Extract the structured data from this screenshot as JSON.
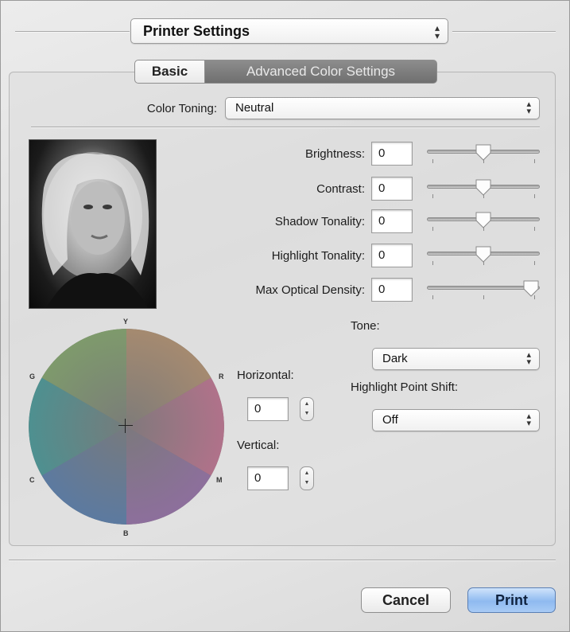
{
  "header": {
    "presets_popup": "Printer Settings"
  },
  "tabs": [
    {
      "label": "Basic",
      "active": false
    },
    {
      "label": "Advanced Color Settings",
      "active": true
    }
  ],
  "color_toning": {
    "label": "Color Toning:",
    "value": "Neutral"
  },
  "adjustments": [
    {
      "label": "Brightness:",
      "value": "0",
      "slider_level": 0.5
    },
    {
      "label": "Contrast:",
      "value": "0",
      "slider_level": 0.5
    },
    {
      "label": "Shadow Tonality:",
      "value": "0",
      "slider_level": 0.5
    },
    {
      "label": "Highlight Tonality:",
      "value": "0",
      "slider_level": 0.5
    },
    {
      "label": "Max Optical Density:",
      "value": "0",
      "slider_level": 1.0
    }
  ],
  "wheel": {
    "top": "Y",
    "left_upper": "G",
    "right_upper": "R",
    "left_lower": "C",
    "right_lower": "M",
    "bottom": "B"
  },
  "horizontal": {
    "label": "Horizontal:",
    "value": "0"
  },
  "vertical": {
    "label": "Vertical:",
    "value": "0"
  },
  "tone": {
    "label": "Tone:",
    "value": "Dark"
  },
  "highlight_point_shift": {
    "label": "Highlight Point Shift:",
    "value": "Off"
  },
  "buttons": {
    "cancel": "Cancel",
    "print": "Print"
  },
  "colors": {
    "print_button": "#8fbaf0",
    "tab_active": "#7d7d7d"
  }
}
